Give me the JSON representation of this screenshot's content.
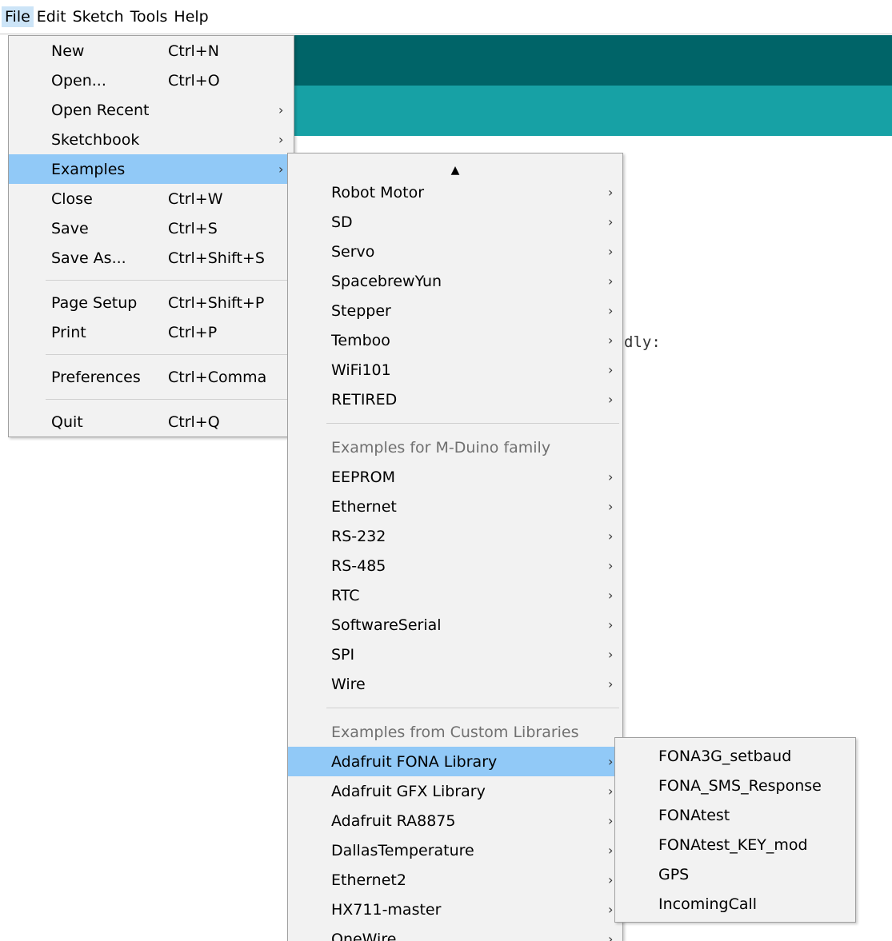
{
  "menubar": {
    "items": [
      "File",
      "Edit",
      "Sketch",
      "Tools",
      "Help"
    ],
    "active": "File"
  },
  "editor": {
    "visible_text": "dly:"
  },
  "colors": {
    "toolbar": "#006468",
    "header": "#17a1a5",
    "menu_bg": "#f2f2f2",
    "highlight": "#91c9f7"
  },
  "file_menu": {
    "items": [
      {
        "label": "New",
        "shortcut": "Ctrl+N"
      },
      {
        "label": "Open...",
        "shortcut": "Ctrl+O"
      },
      {
        "label": "Open Recent",
        "shortcut": "",
        "submenu": true
      },
      {
        "label": "Sketchbook",
        "shortcut": "",
        "submenu": true
      },
      {
        "label": "Examples",
        "shortcut": "",
        "submenu": true,
        "highlighted": true
      },
      {
        "label": "Close",
        "shortcut": "Ctrl+W"
      },
      {
        "label": "Save",
        "shortcut": "Ctrl+S"
      },
      {
        "label": "Save As...",
        "shortcut": "Ctrl+Shift+S"
      },
      {
        "label": "Page Setup",
        "shortcut": "Ctrl+Shift+P"
      },
      {
        "label": "Print",
        "shortcut": "Ctrl+P"
      },
      {
        "label": "Preferences",
        "shortcut": "Ctrl+Comma"
      },
      {
        "label": "Quit",
        "shortcut": "Ctrl+Q"
      }
    ]
  },
  "examples_menu": {
    "scroll_up_glyph": "▲",
    "group1": [
      "Robot Motor",
      "SD",
      "Servo",
      "SpacebrewYun",
      "Stepper",
      "Temboo",
      "WiFi101",
      "RETIRED"
    ],
    "header2": "Examples for M-Duino family",
    "group2": [
      "EEPROM",
      "Ethernet",
      "RS-232",
      "RS-485",
      "RTC",
      "SoftwareSerial",
      "SPI",
      "Wire"
    ],
    "header3": "Examples from Custom Libraries",
    "group3": [
      "Adafruit FONA Library",
      "Adafruit GFX Library",
      "Adafruit RA8875",
      "DallasTemperature",
      "Ethernet2",
      "HX711-master",
      "OneWire"
    ],
    "highlighted": "Adafruit FONA Library"
  },
  "fona_menu": {
    "items": [
      "FONA3G_setbaud",
      "FONA_SMS_Response",
      "FONAtest",
      "FONAtest_KEY_mod",
      "GPS",
      "IncomingCall"
    ]
  }
}
